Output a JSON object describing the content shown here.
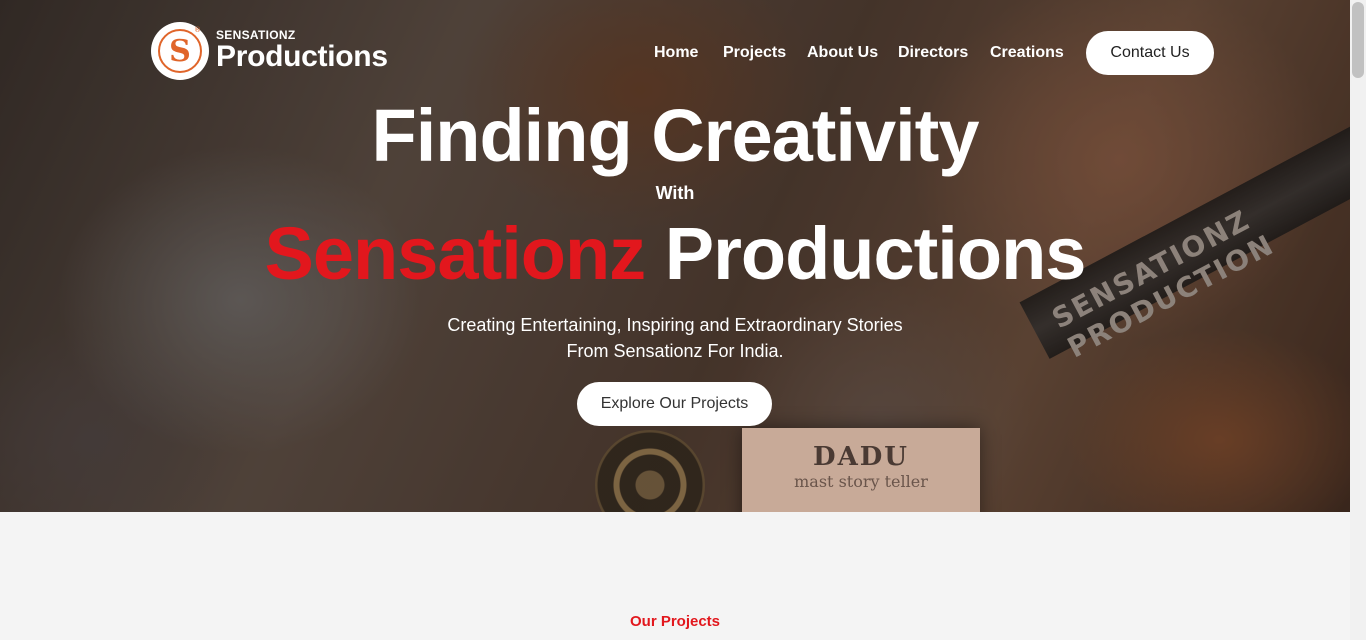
{
  "brand": {
    "small": "SENSATIONZ",
    "big": "Productions",
    "mark": "S",
    "reg": "®"
  },
  "nav": {
    "items": [
      "Home",
      "Projects",
      "About Us",
      "Directors",
      "Creations"
    ],
    "contact_label": "Contact Us"
  },
  "hero": {
    "line1": "Finding Creativity",
    "with": "With",
    "accent": "Sensationz",
    "line2_rest": "Productions",
    "subtitle_line1": "Creating Entertaining, Inspiring and Extraordinary Stories",
    "subtitle_line2": "From Sensationz For India.",
    "cta_label": "Explore Our Projects",
    "film_band_text": "SENSATIONZ PRODUCTION",
    "card_title": "DADU",
    "card_subtitle": "mast story teller"
  },
  "section": {
    "label": "Our Projects"
  },
  "colors": {
    "accent": "#e2171d",
    "logo_orange": "#e0652a",
    "page_bg": "#f4f4f4"
  }
}
